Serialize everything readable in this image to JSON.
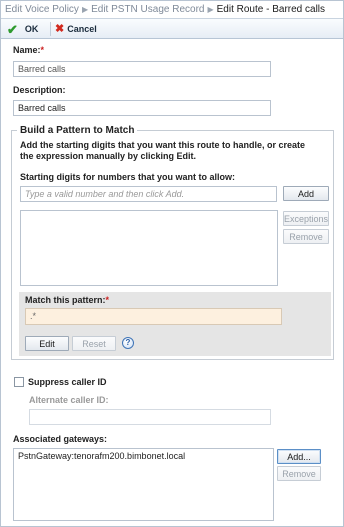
{
  "breadcrumb": {
    "items": [
      "Edit Voice Policy",
      "Edit PSTN Usage Record"
    ],
    "current": "Edit Route - Barred calls",
    "separator": "▶"
  },
  "toolbar": {
    "ok_label": "OK",
    "cancel_label": "Cancel"
  },
  "form": {
    "name_label": "Name:",
    "name_value": "Barred calls",
    "description_label": "Description:",
    "description_value": "Barred calls",
    "required_marker": "*"
  },
  "pattern_section": {
    "legend": "Build a Pattern to Match",
    "description": "Add the starting digits that you want this route to handle, or create the expression manually by clicking Edit.",
    "digits_label": "Starting digits for numbers that you want to allow:",
    "digits_placeholder": "Type a valid number and then click Add.",
    "add_label": "Add",
    "exceptions_label": "Exceptions",
    "remove_label": "Remove",
    "match_label": "Match this pattern:",
    "match_value": ".*",
    "edit_label": "Edit",
    "reset_label": "Reset",
    "help_glyph": "?"
  },
  "caller_id": {
    "suppress_label": "Suppress caller ID",
    "suppress_checked": false,
    "alternate_label": "Alternate caller ID:",
    "alternate_value": ""
  },
  "gateways": {
    "label": "Associated gateways:",
    "items": [
      "PstnGateway:tenorafm200.bimbonet.local"
    ],
    "add_label": "Add...",
    "remove_label": "Remove"
  },
  "colors": {
    "required": "#cc2020",
    "ok_icon": "#2e9a2e",
    "cancel_icon": "#d12a1f",
    "pattern_bg": "#fdf0df",
    "panel_bg": "#e5e5e5"
  }
}
